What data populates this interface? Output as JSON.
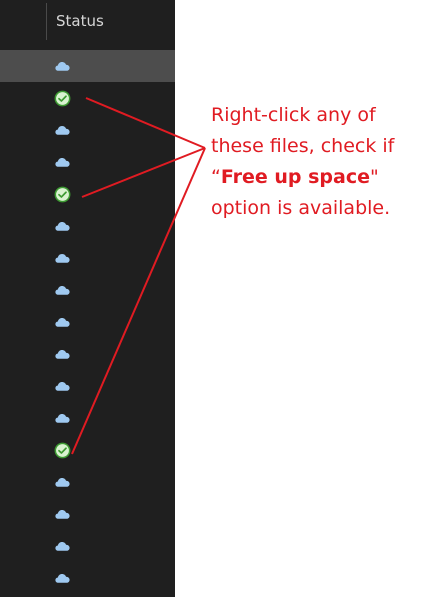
{
  "header": {
    "status_label": "Status"
  },
  "rows": [
    {
      "status": "cloud-icon",
      "selected": true
    },
    {
      "status": "check-icon",
      "selected": false
    },
    {
      "status": "cloud-icon",
      "selected": false
    },
    {
      "status": "cloud-icon",
      "selected": false
    },
    {
      "status": "check-icon",
      "selected": false
    },
    {
      "status": "cloud-icon",
      "selected": false
    },
    {
      "status": "cloud-icon",
      "selected": false
    },
    {
      "status": "cloud-icon",
      "selected": false
    },
    {
      "status": "cloud-icon",
      "selected": false
    },
    {
      "status": "cloud-icon",
      "selected": false
    },
    {
      "status": "cloud-icon",
      "selected": false
    },
    {
      "status": "cloud-icon",
      "selected": false
    },
    {
      "status": "check-icon",
      "selected": false
    },
    {
      "status": "cloud-icon",
      "selected": false
    },
    {
      "status": "cloud-icon",
      "selected": false
    },
    {
      "status": "cloud-icon",
      "selected": false
    },
    {
      "status": "cloud-icon",
      "selected": false
    }
  ],
  "annotation": {
    "line1": "Right-click any of",
    "line2": "these files, check if",
    "line3_open_quote": "“",
    "line3_bold": "Free up space",
    "line3_close_quote": "\"",
    "line4": "option is available."
  },
  "colors": {
    "annotation": "#e01b22",
    "cloud": "#9fc9f0",
    "check_fill": "#d9f3d0",
    "check_stroke": "#3d9a32",
    "background": "#1f1f1f",
    "selected_row": "#4d4d4d"
  }
}
